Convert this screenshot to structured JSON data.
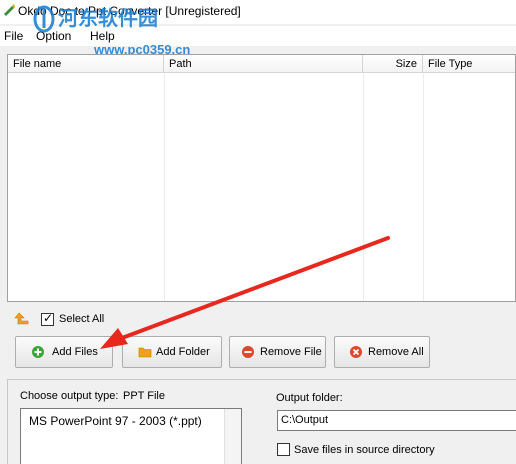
{
  "window": {
    "title": "Okdo Doc to Ppt Converter [Unregistered]"
  },
  "menu": [
    {
      "label": "File"
    },
    {
      "label": "Option"
    },
    {
      "label": "Help"
    }
  ],
  "watermark": {
    "line1": "河东软件园",
    "line2": "www.pc0359.cn"
  },
  "filelist": {
    "columns": [
      {
        "label": "File name"
      },
      {
        "label": "Path"
      },
      {
        "label": "Size"
      },
      {
        "label": "File Type"
      }
    ],
    "rows": []
  },
  "toolbar": {
    "select_all_label": "Select All",
    "select_all_checked": true,
    "up_icon": "arrow-up-icon"
  },
  "buttons": {
    "add_files": "Add Files",
    "add_folder": "Add Folder",
    "remove_file": "Remove File",
    "remove_all": "Remove All"
  },
  "output": {
    "type_label": "Choose output type:",
    "type_value": "PPT File",
    "type_options": [
      "MS PowerPoint 97 - 2003 (*.ppt)"
    ],
    "folder_label": "Output folder:",
    "folder_value": "C:\\Output",
    "save_in_source_label": "Save files in source directory",
    "save_in_source_checked": false
  },
  "colors": {
    "accent_green": "#3aa63a",
    "folder_orange": "#f0a020",
    "remove_red": "#e0482e",
    "annotation_arrow": "#e8281e",
    "watermark_blue": "#1d7fd0"
  }
}
